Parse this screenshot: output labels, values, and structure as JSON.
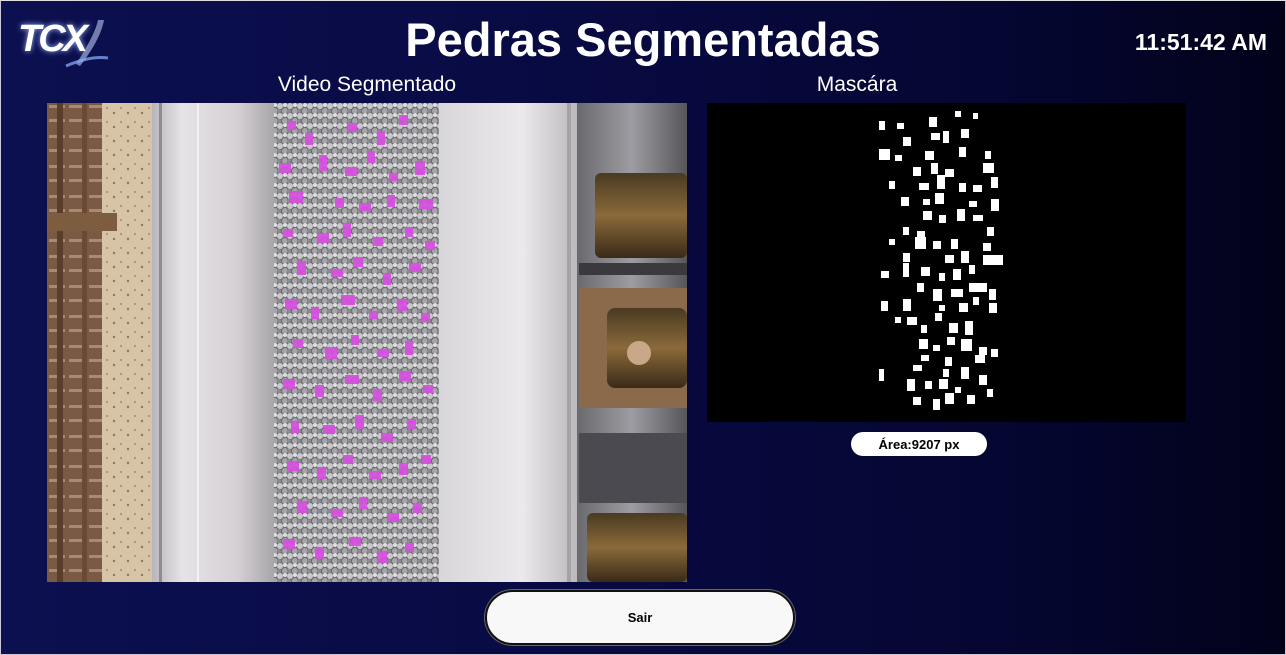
{
  "header": {
    "logo_text": "TCX",
    "title": "Pedras Segmentadas",
    "clock": "11:51:42 AM"
  },
  "panels": {
    "video_label": "Video Segmentado",
    "mask_label": "Mascára"
  },
  "area_badge": "Área:9207 px",
  "exit_button": "Sair",
  "colors": {
    "background": "#080a42",
    "segment_highlight": "#d64fe0",
    "mask_foreground": "#ffffff",
    "mask_background": "#000000"
  }
}
